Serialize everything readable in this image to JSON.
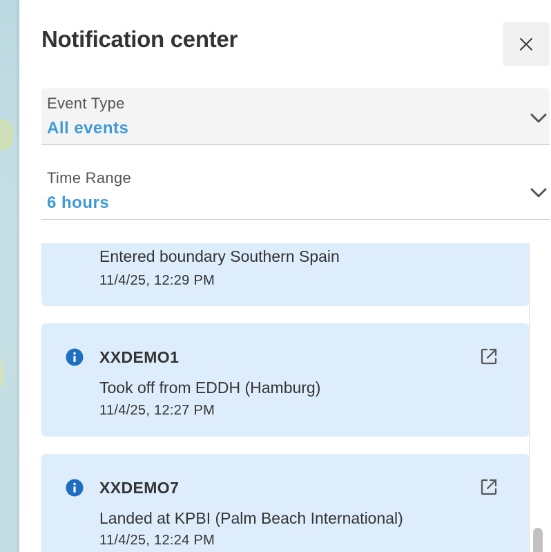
{
  "panel": {
    "title": "Notification center",
    "close_icon": "close-icon"
  },
  "filters": {
    "event_type": {
      "label": "Event Type",
      "value": "All events"
    },
    "time_range": {
      "label": "Time Range",
      "value": "6 hours"
    }
  },
  "notifications": [
    {
      "message": "Entered boundary Southern Spain",
      "time": "11/4/25, 12:29 PM"
    },
    {
      "name": "XXDEMO1",
      "icon": "info-icon",
      "message": "Took off from EDDH (Hamburg)",
      "time": "11/4/25, 12:27 PM"
    },
    {
      "name": "XXDEMO7",
      "icon": "info-icon",
      "message": "Landed at KPBI (Palm Beach International)",
      "time": "11/4/25, 12:24 PM"
    }
  ],
  "colors": {
    "accent": "#3e9ad6",
    "card_background": "#deedfc",
    "info_icon": "#1f6fc0"
  }
}
